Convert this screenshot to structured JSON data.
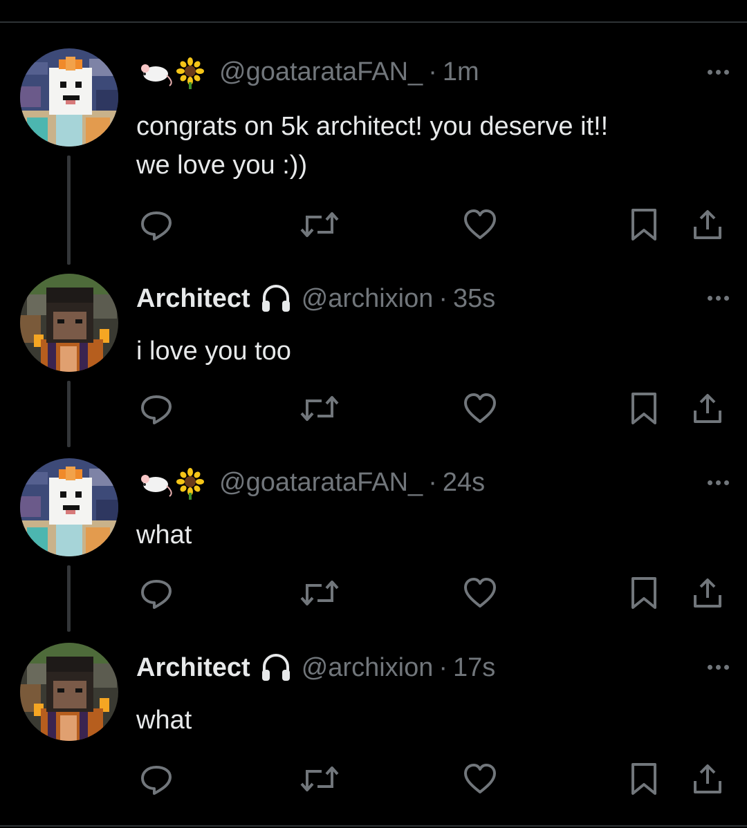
{
  "colors": {
    "background": "#000000",
    "text": "#e7e9ea",
    "secondary_text": "#71767b",
    "divider": "#2f3336"
  },
  "tweets": [
    {
      "display_name": "",
      "name_emoji": "rat-and-sunflower-emoji",
      "handle": "@goatarataFAN_",
      "time": "1m",
      "text": "congrats on 5k architect! you deserve it!!\nwe love you :))",
      "avatar": "white-block-character-avatar"
    },
    {
      "display_name": "Architect",
      "name_emoji": "headphones-icon",
      "handle": "@archixion",
      "time": "35s",
      "text": "i love you too",
      "avatar": "dark-hair-character-avatar"
    },
    {
      "display_name": "",
      "name_emoji": "rat-and-sunflower-emoji",
      "handle": "@goatarataFAN_",
      "time": "24s",
      "text": "what",
      "avatar": "white-block-character-avatar"
    },
    {
      "display_name": "Architect",
      "name_emoji": "headphones-icon",
      "handle": "@archixion",
      "time": "17s",
      "text": "what",
      "avatar": "dark-hair-character-avatar"
    }
  ],
  "separator": "·",
  "action_icons": [
    "reply-icon",
    "retweet-icon",
    "like-icon",
    "bookmark-icon",
    "share-icon"
  ]
}
